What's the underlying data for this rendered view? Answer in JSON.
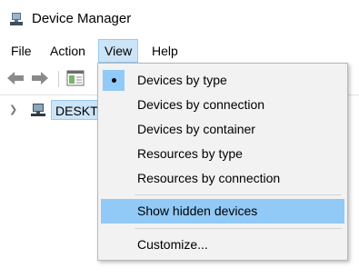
{
  "window": {
    "title": "Device Manager"
  },
  "menubar": {
    "items": [
      "File",
      "Action",
      "View",
      "Help"
    ],
    "active": "View"
  },
  "toolbar": {
    "icons": [
      "back-arrow-icon",
      "forward-arrow-icon",
      "properties-icon"
    ]
  },
  "tree": {
    "root_label": "DESKTO"
  },
  "view_menu": {
    "items": [
      {
        "label": "Devices by type",
        "checked": true
      },
      {
        "label": "Devices by connection"
      },
      {
        "label": "Devices by container"
      },
      {
        "label": "Resources by type"
      },
      {
        "label": "Resources by connection"
      },
      {
        "label": "Show hidden devices",
        "hovered": true
      },
      {
        "label": "Customize..."
      }
    ]
  },
  "colors": {
    "highlight": "#91c9f7",
    "selection": "#cce4f7",
    "menu_bg": "#f2f2f2"
  }
}
